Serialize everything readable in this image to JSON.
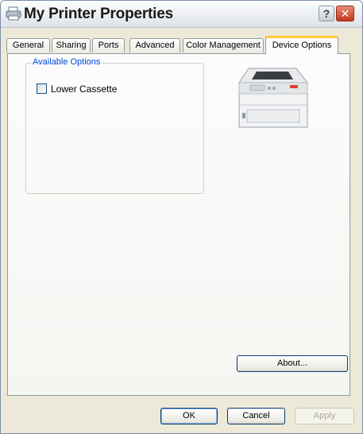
{
  "window": {
    "title": "My Printer Properties",
    "help_label": "?",
    "close_label": "✕"
  },
  "tabs": [
    {
      "label": "General",
      "active": false
    },
    {
      "label": "Sharing",
      "active": false
    },
    {
      "label": "Ports",
      "active": false
    },
    {
      "label": "Advanced",
      "active": false
    },
    {
      "label": "Color Management",
      "active": false
    },
    {
      "label": "Device Options",
      "active": true
    }
  ],
  "available_options": {
    "group_label": "Available Options",
    "items": [
      {
        "label": "Lower Cassette",
        "checked": false
      }
    ]
  },
  "buttons": {
    "about": "About...",
    "ok": "OK",
    "cancel": "Cancel",
    "apply": "Apply"
  },
  "colors": {
    "accent_tab": "#ffc83c",
    "group_label": "#0046d5",
    "close_button": "#c3371a"
  }
}
